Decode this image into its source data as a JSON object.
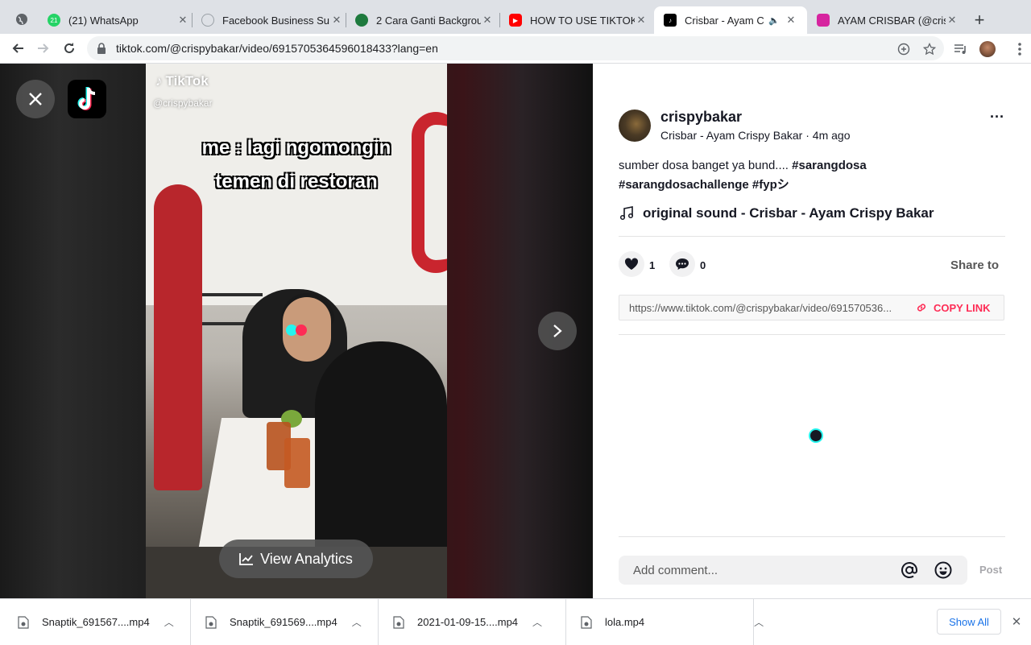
{
  "browser": {
    "tabs": [
      {
        "title": "(21) WhatsApp",
        "favicon": "whatsapp-icon",
        "badge": "21",
        "color": "#25d366"
      },
      {
        "title": "Facebook Business Su",
        "favicon": "facebook-business-icon",
        "color": "#9aa0a6"
      },
      {
        "title": "2 Cara Ganti Backgrou",
        "favicon": "site-icon",
        "color": "#1e7a3e"
      },
      {
        "title": "HOW TO USE TIKTOK",
        "favicon": "youtube-icon",
        "color": "#ff0000"
      },
      {
        "title": "Crisbar - Ayam Cri",
        "favicon": "tiktok-icon",
        "color": "#000000",
        "active": true
      },
      {
        "title": "AYAM CRISBAR (@cris",
        "favicon": "instagram-icon",
        "color": "#d6249f"
      }
    ],
    "new_tab": "+",
    "url": "tiktok.com/@crispybakar/video/6915705364596018433?lang=en"
  },
  "video": {
    "watermark": "TikTok",
    "handle": "@crispybakar",
    "caption_line1": "me : lagi ngomongin",
    "caption_line2": "temen di restoran",
    "analytics_label": "View Analytics"
  },
  "post": {
    "username": "crispybakar",
    "nickname": "Crisbar - Ayam Crispy Bakar",
    "time": "4m ago",
    "separator": " · ",
    "more": "···",
    "desc_text": "sumber dosa banget ya bund.... ",
    "tags": [
      "#sarangdosa",
      "#sarangdosachallenge",
      "#fypシ"
    ],
    "music": "original sound - Crisbar - Ayam Crispy Bakar",
    "likes": "1",
    "comments": "0",
    "share_to": "Share to",
    "share_link": "https://www.tiktok.com/@crispybakar/video/691570536...",
    "copy_link": "COPY LINK",
    "comment_placeholder": "Add comment...",
    "post_label": "Post",
    "accent": "#fe2c55"
  },
  "downloads": {
    "items": [
      "Snaptik_691567....mp4",
      "Snaptik_691569....mp4",
      "2021-01-09-15....mp4",
      "lola.mp4"
    ],
    "show_all": "Show All",
    "close": "✕"
  }
}
